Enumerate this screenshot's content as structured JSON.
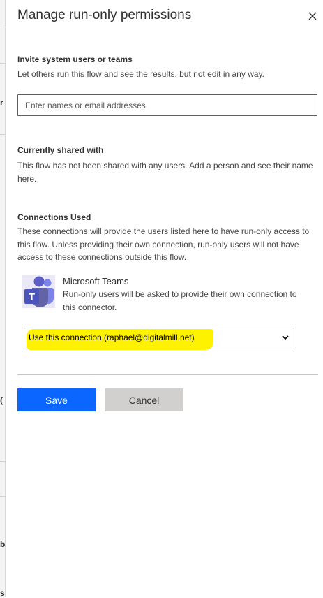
{
  "panel": {
    "title": "Manage run-only permissions",
    "close_icon": "close-icon"
  },
  "invite": {
    "heading": "Invite system users or teams",
    "description": "Let others run this flow and see the results, but not edit in any way.",
    "placeholder": "Enter names or email addresses"
  },
  "shared": {
    "heading": "Currently shared with",
    "description": "This flow has not been shared with any users. Add a person and see their name here."
  },
  "connections": {
    "heading": "Connections Used",
    "description": "These connections will provide the users listed here to have run-only access to this flow. Unless providing their own connection, run-only users will not have access to these connections outside this flow.",
    "items": [
      {
        "name": "Microsoft Teams",
        "icon": "microsoft-teams-icon",
        "description": "Run-only users will be asked to provide their own connection to this connector.",
        "selected_option": "Use this connection (raphael@digitalmill.net)",
        "highlight_color": "#fff200"
      }
    ]
  },
  "actions": {
    "save_label": "Save",
    "cancel_label": "Cancel",
    "save_color": "#0a66ff",
    "cancel_color": "#d2d0ce"
  },
  "background": {
    "fragments": [
      "r",
      "(",
      "b",
      "s"
    ]
  }
}
